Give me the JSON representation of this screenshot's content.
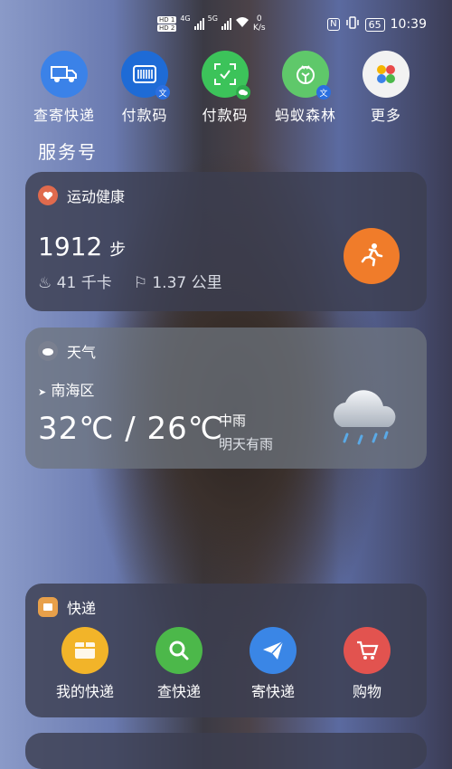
{
  "status_bar": {
    "hd1": "HD 1",
    "hd2": "HD 2",
    "net1": "4G",
    "net2": "5G",
    "speed_value": "0",
    "speed_unit": "K/s",
    "nfc": "N",
    "battery": "65",
    "time": "10:39"
  },
  "shortcuts": [
    {
      "label": "查寄快递",
      "icon": "truck-icon",
      "color": "#3b82e8"
    },
    {
      "label": "付款码",
      "icon": "alipay-barcode-icon",
      "color": "#1e6bd6",
      "badge": "文"
    },
    {
      "label": "付款码",
      "icon": "wechat-scan-icon",
      "color": "#3cc35a",
      "badge": "wechat"
    },
    {
      "label": "蚂蚁森林",
      "icon": "ant-forest-icon",
      "color": "#5fc86a",
      "badge": "文"
    },
    {
      "label": "更多",
      "icon": "more-apps-icon",
      "color": "#f2f2f2"
    }
  ],
  "section_title": "服务号",
  "health_card": {
    "title": "运动健康",
    "steps": "1912",
    "steps_unit": "步",
    "calories": "41 千卡",
    "distance": "1.37 公里"
  },
  "weather_card": {
    "title": "天气",
    "location": "南海区",
    "temperature": "32℃ / 26℃",
    "condition": "中雨",
    "tomorrow": "明天有雨"
  },
  "express_card": {
    "title": "快递",
    "items": [
      {
        "label": "我的快递",
        "icon": "package-icon",
        "color": "#f2b429"
      },
      {
        "label": "查快递",
        "icon": "search-icon",
        "color": "#4cb84a"
      },
      {
        "label": "寄快递",
        "icon": "send-plane-icon",
        "color": "#3a86e6"
      },
      {
        "label": "购物",
        "icon": "shopping-cart-icon",
        "color": "#e2534f"
      }
    ]
  }
}
